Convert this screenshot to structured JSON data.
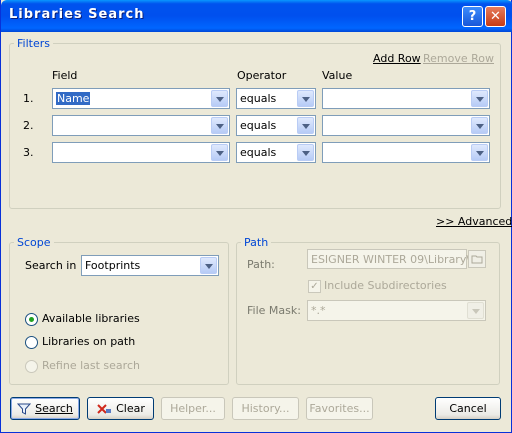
{
  "window": {
    "title": "Libraries Search",
    "help_glyph": "?",
    "close_glyph": "✕"
  },
  "filters": {
    "label": "Filters",
    "add_row": "Add Row",
    "remove_row": "Remove Row",
    "headers": {
      "field": "Field",
      "operator": "Operator",
      "value": "Value"
    },
    "rows": [
      {
        "num": "1.",
        "field": "Name",
        "operator": "equals",
        "value": ""
      },
      {
        "num": "2.",
        "field": "",
        "operator": "equals",
        "value": ""
      },
      {
        "num": "3.",
        "field": "",
        "operator": "equals",
        "value": ""
      }
    ]
  },
  "advanced": ">> Advanced",
  "scope": {
    "label": "Scope",
    "search_in_label": "Search in",
    "search_in_value": "Footprints",
    "options": [
      "Available libraries",
      "Libraries on path",
      "Refine last search"
    ],
    "selected": 0
  },
  "path": {
    "label": "Path",
    "path_label": "Path:",
    "path_value": "ESIGNER WINTER 09\\Library\\",
    "include_subdirs": "Include Subdirectories",
    "file_mask_label": "File Mask:",
    "file_mask_value": "*.*"
  },
  "buttons": {
    "search": "Search",
    "clear": "Clear",
    "helper": "Helper...",
    "history": "History...",
    "favorites": "Favorites...",
    "cancel": "Cancel"
  }
}
